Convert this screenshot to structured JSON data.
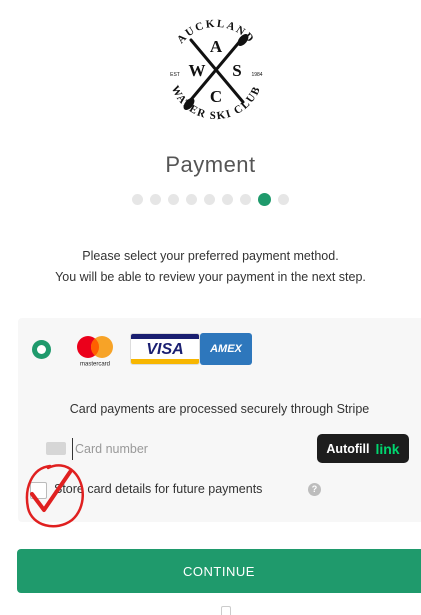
{
  "logo": {
    "top_text": "AUCKLAND",
    "bottom_text": "WATER SKI CLUB",
    "letters": [
      "A",
      "W",
      "S",
      "C"
    ],
    "est_left": "EST",
    "est_right": "1984",
    "icon": "crossed-paddles-logo"
  },
  "page": {
    "title": "Payment",
    "steps_total": 9,
    "active_step": 8
  },
  "intro": {
    "line1": "Please select your preferred payment method.",
    "line2": "You will be able to review your payment in the next step."
  },
  "payment": {
    "method_selected": true,
    "brands": [
      "mastercard",
      "VISA",
      "AMEX"
    ],
    "mastercard_label": "mastercard",
    "visa_label": "VISA",
    "amex_label": "AMEX",
    "secure_note": "Card payments are processed securely through Stripe",
    "card_placeholder": "Card number",
    "autofill_label": "Autofill",
    "autofill_link": "link",
    "store_label": "Store card details for future payments",
    "store_checked": false
  },
  "actions": {
    "continue_label": "CONTINUE"
  },
  "colors": {
    "accent": "#1f9a6c",
    "autofill_bg": "#1d1d1d",
    "link_green": "#00d66f",
    "annotation_red": "#e02020"
  }
}
